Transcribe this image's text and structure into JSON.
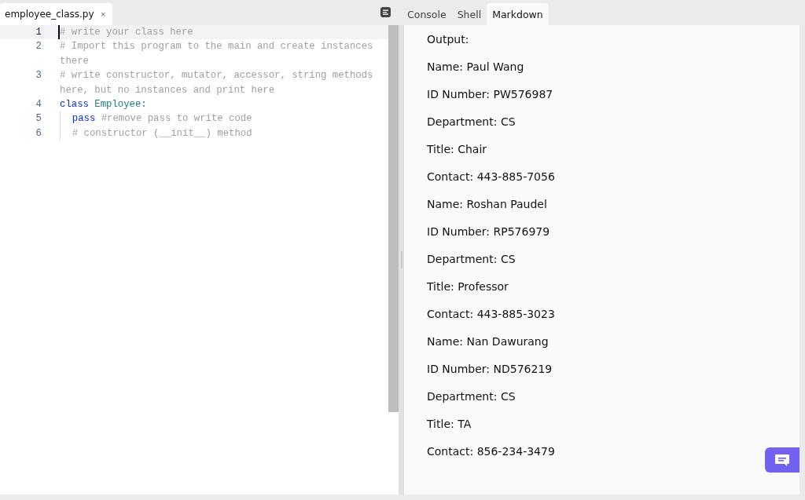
{
  "file_tab": {
    "label": "employee_class.py",
    "close": "×"
  },
  "editor": {
    "lines": [
      {
        "number": "1",
        "current": true,
        "tokens": [
          {
            "kind": "comment",
            "text": "# write your class here"
          }
        ]
      },
      {
        "number": "2",
        "current": false,
        "tokens": [
          {
            "kind": "comment",
            "text": "# Import this program to the main and create instances there"
          }
        ]
      },
      {
        "number": "3",
        "current": false,
        "tokens": [
          {
            "kind": "comment",
            "text": "# write constructor, mutator, accessor, string methods here, but no instances and print here"
          }
        ]
      },
      {
        "number": "4",
        "current": false,
        "tokens": [
          {
            "kind": "keyword",
            "text": "class"
          },
          {
            "kind": "name",
            "text": "Employee:"
          }
        ],
        "children": [
          {
            "number": "5",
            "current": false,
            "tokens": [
              {
                "kind": "keyword",
                "text": "pass"
              },
              {
                "kind": "comment",
                "text": "#remove pass to write code"
              }
            ]
          },
          {
            "number": "6",
            "current": false,
            "tokens": [
              {
                "kind": "comment",
                "text": "# constructor (__init__) method"
              }
            ]
          }
        ]
      }
    ]
  },
  "output_tabs": [
    {
      "label": "Console",
      "selected": false
    },
    {
      "label": "Shell",
      "selected": false
    },
    {
      "label": "Markdown",
      "selected": true
    }
  ],
  "output": [
    "Output:",
    "Name: Paul Wang",
    "ID Number: PW576987",
    "Department: CS",
    "Title: Chair",
    "Contact: 443-885-7056",
    "Name: Roshan Paudel",
    "ID Number: RP576979",
    "Department: CS",
    "Title: Professor",
    "Contact: 443-885-3023",
    "Name: Nan Dawurang",
    "ID Number: ND576219",
    "Department: CS",
    "Title: TA",
    "Contact: 856-234-3479"
  ]
}
